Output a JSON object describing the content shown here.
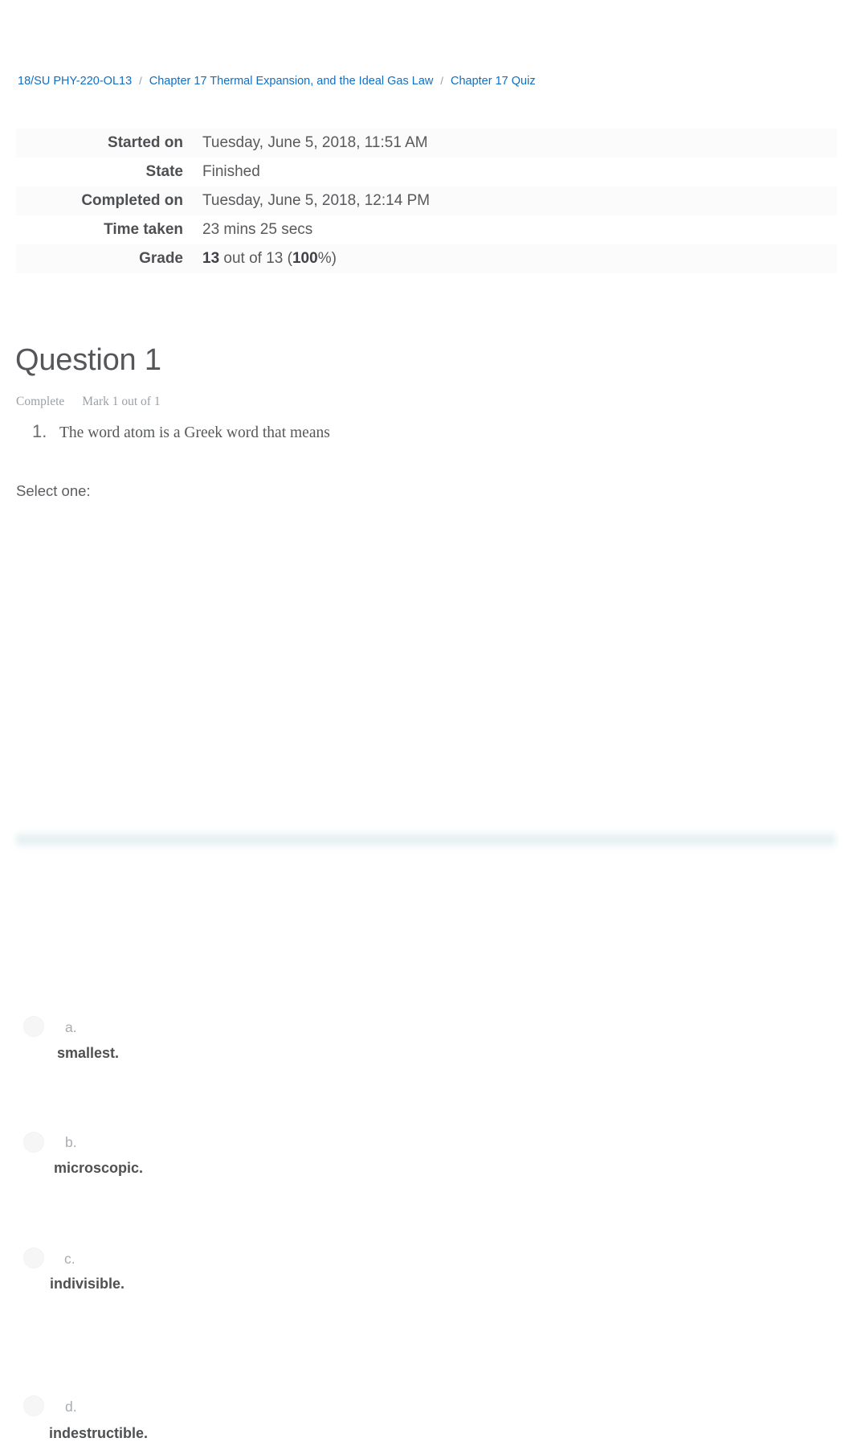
{
  "breadcrumb": {
    "separator": "/",
    "items": [
      {
        "label": "18/SU PHY-220-OL13"
      },
      {
        "label": "Chapter 17 Thermal Expansion, and the Ideal Gas Law"
      },
      {
        "label": "Chapter 17 Quiz"
      }
    ]
  },
  "summary": {
    "rows": [
      {
        "label": "Started on",
        "value": "Tuesday, June 5, 2018, 11:51 AM"
      },
      {
        "label": "State",
        "value": "Finished"
      },
      {
        "label": "Completed on",
        "value": "Tuesday, June 5, 2018, 12:14 PM"
      },
      {
        "label": "Time taken",
        "value": "23 mins 25 secs"
      }
    ],
    "grade": {
      "label": "Grade",
      "score": "13",
      "middle": " out of 13 (",
      "percent": "100",
      "suffix": "%)"
    }
  },
  "question": {
    "title": "Question 1",
    "state": "Complete",
    "mark": "Mark 1 out of 1",
    "number": "1.",
    "stem": "The word atom is a Greek word that means",
    "select_label": "Select one:",
    "options": [
      {
        "letter": "a.",
        "text": "smallest."
      },
      {
        "letter": "b.",
        "text": "microscopic."
      },
      {
        "letter": "c.",
        "text": "indivisible."
      },
      {
        "letter": "d.",
        "text": "indestructible."
      }
    ]
  },
  "colors": {
    "link": "#0f6fc5",
    "text": "#565859",
    "muted": "#9aa0a6",
    "feedback_band": "#dfeced"
  }
}
